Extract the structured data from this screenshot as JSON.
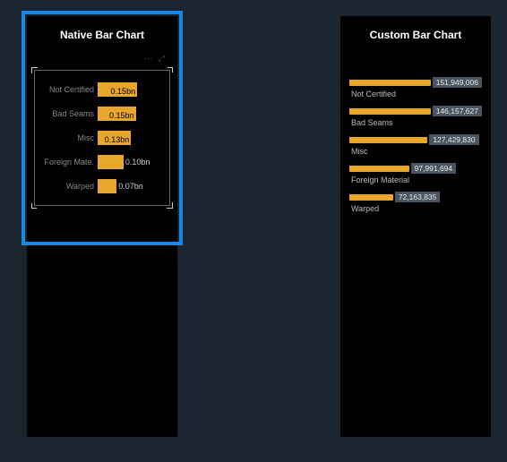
{
  "colors": {
    "accent": "#e8a62b",
    "selection": "#1b87e5"
  },
  "panels": {
    "left": {
      "title": "Native Bar Chart"
    },
    "right": {
      "title": "Custom Bar Chart"
    }
  },
  "native": {
    "rows": [
      {
        "label": "Not Certified",
        "value_label": "0.15bn",
        "width_pct": 58,
        "label_inside": true
      },
      {
        "label": "Bad Seams",
        "value_label": "0.15bn",
        "width_pct": 56,
        "label_inside": true
      },
      {
        "label": "Misc",
        "value_label": "0.13bn",
        "width_pct": 49,
        "label_inside": true
      },
      {
        "label": "Foreign Mate.",
        "value_label": "0.10bn",
        "width_pct": 38,
        "label_inside": false
      },
      {
        "label": "Warped",
        "value_label": "0.07bn",
        "width_pct": 28,
        "label_inside": false
      }
    ]
  },
  "custom": {
    "rows": [
      {
        "label": "Not Certified",
        "value_label": "151,949,006",
        "width_pct": 70
      },
      {
        "label": "Bad Seams",
        "value_label": "146,157,627",
        "width_pct": 67
      },
      {
        "label": "Misc",
        "value_label": "127,429,830",
        "width_pct": 59
      },
      {
        "label": "Foreign Material",
        "value_label": "97,991,694",
        "width_pct": 45
      },
      {
        "label": "Warped",
        "value_label": "72,163,835",
        "width_pct": 33
      }
    ]
  },
  "chart_data": [
    {
      "type": "bar",
      "title": "Native Bar Chart",
      "orientation": "horizontal",
      "categories": [
        "Not Certified",
        "Bad Seams",
        "Misc",
        "Foreign Mate.",
        "Warped"
      ],
      "values": [
        0.15,
        0.15,
        0.13,
        0.1,
        0.07
      ],
      "unit": "bn",
      "xlabel": "",
      "ylabel": ""
    },
    {
      "type": "bar",
      "title": "Custom Bar Chart",
      "orientation": "horizontal",
      "categories": [
        "Not Certified",
        "Bad Seams",
        "Misc",
        "Foreign Material",
        "Warped"
      ],
      "values": [
        151949006,
        146157627,
        127429830,
        97991694,
        72163835
      ],
      "xlabel": "",
      "ylabel": ""
    }
  ]
}
